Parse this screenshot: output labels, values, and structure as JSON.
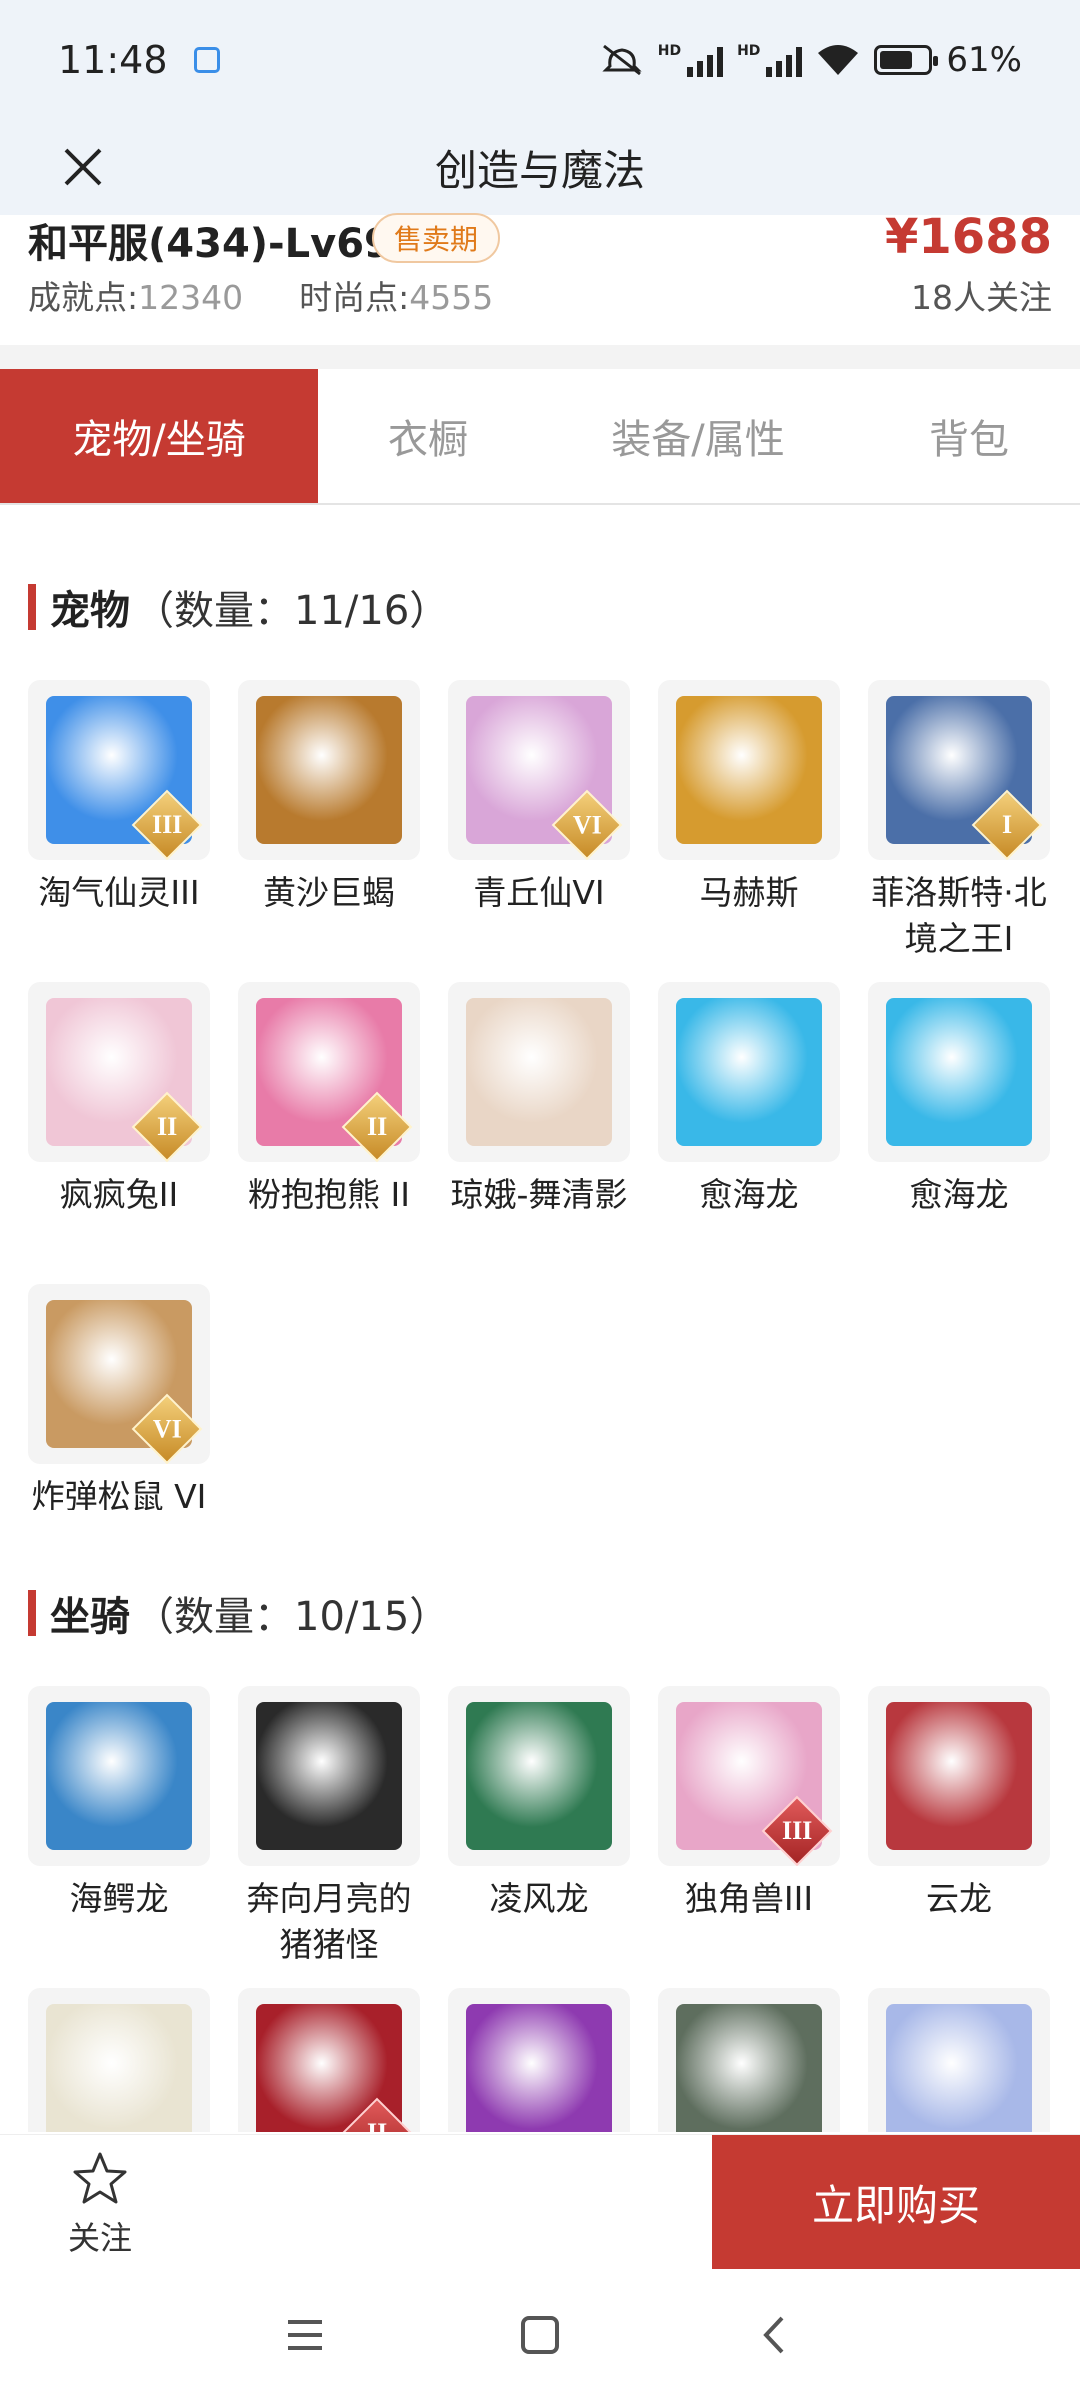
{
  "status_bar": {
    "time": "11:48",
    "battery": "61%"
  },
  "nav": {
    "title": "创造与魔法"
  },
  "summary": {
    "server": "和平服(434)-Lv69",
    "badge": "售卖期",
    "price": "¥1688",
    "achievement_label": "成就点:",
    "achievement_value": "12340",
    "fashion_label": "时尚点:",
    "fashion_value": "4555",
    "followers": "18人关注"
  },
  "tabs": [
    {
      "label": "宠物/坐骑",
      "active": true
    },
    {
      "label": "衣橱",
      "active": false
    },
    {
      "label": "装备/属性",
      "active": false
    },
    {
      "label": "背包",
      "active": false
    }
  ],
  "pets": {
    "name": "宠物",
    "count": "（数量：11/16）",
    "items": [
      {
        "label": "淘气仙灵III",
        "tier": "III",
        "color": "#3f8fe8"
      },
      {
        "label": "黄沙巨蝎",
        "tier": "",
        "color": "#b87a2e"
      },
      {
        "label": "青丘仙VI",
        "tier": "VI",
        "color": "#d9a6d8"
      },
      {
        "label": "马赫斯",
        "tier": "",
        "color": "#d69b2f"
      },
      {
        "label": "菲洛斯特·北境之王I",
        "tier": "I",
        "color": "#4b6fa8"
      },
      {
        "label": "疯疯兔II",
        "tier": "II",
        "color": "#f0c6d6"
      },
      {
        "label": "粉抱抱熊 II",
        "tier": "II",
        "color": "#e87ba8"
      },
      {
        "label": "琼娥-舞清影",
        "tier": "",
        "color": "#e9d6c6"
      },
      {
        "label": "愈海龙",
        "tier": "",
        "color": "#39b8e8"
      },
      {
        "label": "愈海龙",
        "tier": "",
        "color": "#39b8e8"
      },
      {
        "label": "炸弹松鼠 VI",
        "tier": "VI",
        "color": "#c99a62"
      }
    ]
  },
  "mounts": {
    "name": "坐骑",
    "count": "（数量：10/15）",
    "items": [
      {
        "label": "海鳄龙",
        "tier": "",
        "color": "#3a86c8"
      },
      {
        "label": "奔向月亮的猪猪怪",
        "tier": "",
        "color": "#2a2a2a"
      },
      {
        "label": "凌风龙",
        "tier": "",
        "color": "#2f7a52"
      },
      {
        "label": "独角兽III",
        "tier": "III",
        "color": "#e8a6c8"
      },
      {
        "label": "云龙",
        "tier": "",
        "color": "#b8383e"
      },
      {
        "label": "",
        "tier": "",
        "color": "#e9e4d2"
      },
      {
        "label": "",
        "tier": "II",
        "color": "#a8202a"
      },
      {
        "label": "",
        "tier": "",
        "color": "#8e3ab0"
      },
      {
        "label": "",
        "tier": "",
        "color": "#5e6e5e"
      },
      {
        "label": "",
        "tier": "",
        "color": "#a8b8e8"
      }
    ]
  },
  "bottom": {
    "follow_label": "关注",
    "buy_label": "立即购买"
  }
}
